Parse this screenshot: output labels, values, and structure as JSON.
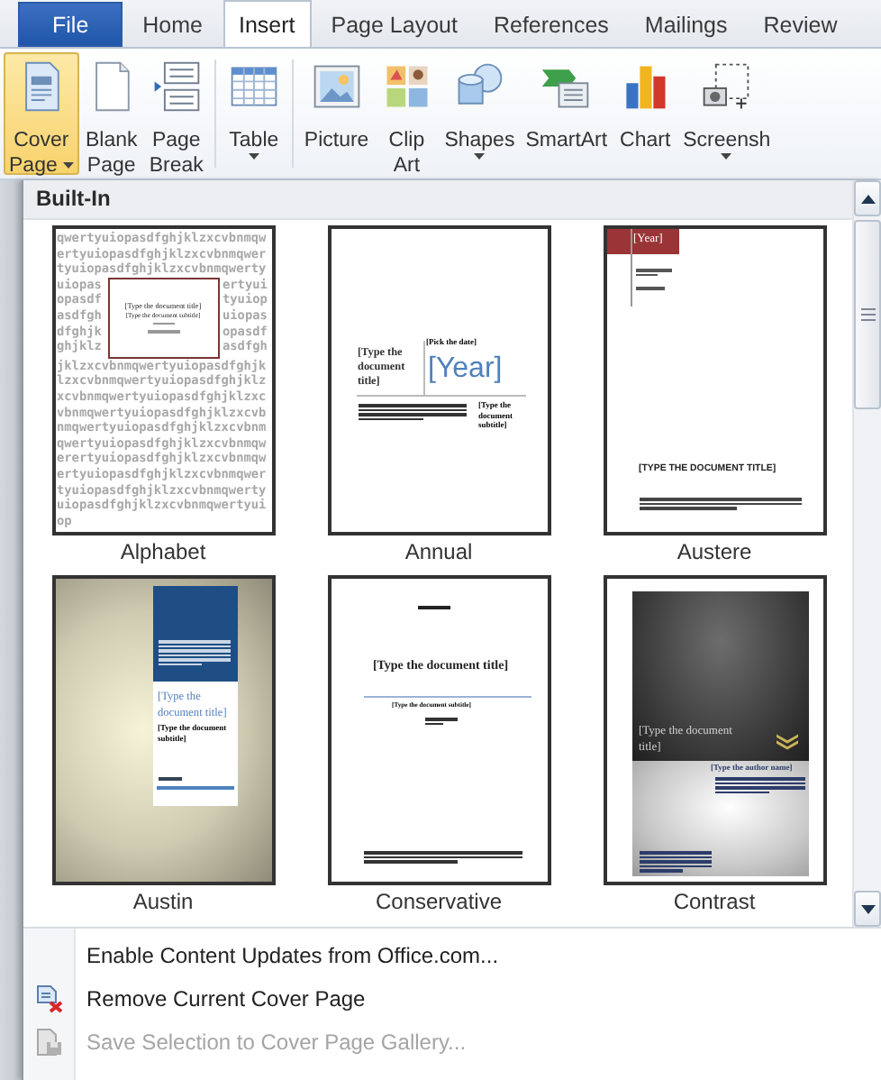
{
  "tabs": [
    {
      "label": "File",
      "kind": "file",
      "selected": false
    },
    {
      "label": "Home",
      "kind": "tab",
      "selected": false
    },
    {
      "label": "Insert",
      "kind": "tab",
      "selected": true
    },
    {
      "label": "Page Layout",
      "kind": "tab",
      "selected": false
    },
    {
      "label": "References",
      "kind": "tab",
      "selected": false
    },
    {
      "label": "Mailings",
      "kind": "tab",
      "selected": false
    },
    {
      "label": "Review",
      "kind": "tab",
      "selected": false
    }
  ],
  "ribbon": {
    "groups": [
      {
        "buttons": [
          {
            "lines": [
              "Cover",
              "Page"
            ],
            "kind": "cover-page",
            "dropdown": true,
            "selected": true
          },
          {
            "lines": [
              "Blank",
              "Page"
            ],
            "kind": "blank-page",
            "dropdown": false,
            "selected": false
          },
          {
            "lines": [
              "Page",
              "Break"
            ],
            "kind": "page-break",
            "dropdown": false,
            "selected": false
          }
        ]
      },
      {
        "buttons": [
          {
            "lines": [
              "Table"
            ],
            "kind": "table",
            "dropdown": true,
            "selected": false
          }
        ]
      },
      {
        "buttons": [
          {
            "lines": [
              "Picture"
            ],
            "kind": "picture",
            "dropdown": false,
            "selected": false
          },
          {
            "lines": [
              "Clip",
              "Art"
            ],
            "kind": "clip-art",
            "dropdown": false,
            "selected": false
          },
          {
            "lines": [
              "Shapes"
            ],
            "kind": "shapes",
            "dropdown": true,
            "selected": false
          },
          {
            "lines": [
              "SmartArt"
            ],
            "kind": "smartart",
            "dropdown": false,
            "selected": false
          },
          {
            "lines": [
              "Chart"
            ],
            "kind": "chart",
            "dropdown": false,
            "selected": false
          },
          {
            "lines": [
              "Screensh"
            ],
            "kind": "screenshot",
            "dropdown": true,
            "selected": false
          }
        ]
      }
    ]
  },
  "gallery": {
    "heading": "Built-In",
    "items": [
      {
        "name": "Alphabet",
        "kind": "alphabet",
        "texts": [
          "qwertyuiopasdfghjklzxcvbnmqwertyuiopasdfghjklzxcvbnmqwertyuiopasdfghjklzxcvbnmqwerty",
          "[Type the document title]",
          "[Type the document subtitle]",
          "uiopasopasdfasdfghdfghjkghjklz",
          "ertyuityuiopuiopasopasdfasdfgh",
          "jklzxcvbnmqwertyuiopasdfghjklzxcvbnmqwertyuiopasdfghjklzxcvbnmqwertyuiopasdfghjklzxcvbnmqwertyuiopasdfghjklzxcvbnmqwertyuiopasdfghjklzxcvbnmqwertyuiopasdfghjklzxcvbnmqwerertyuiopasdfghjklzxcvbnmqwertyuiopasdfghjklzxcvbnmqwertyuiopasdfghjklzxcvbnmqwertyuiopasdfghjklzxcvbnmqwertyuiop"
        ]
      },
      {
        "name": "Annual",
        "kind": "annual",
        "texts": [
          "[Type the document title]",
          "[Pick the date]",
          "[Year]",
          "[Type the document subtitle]"
        ]
      },
      {
        "name": "Austere",
        "kind": "austere",
        "texts": [
          "[Year]",
          "[TYPE THE DOCUMENT TITLE]"
        ]
      },
      {
        "name": "Austin",
        "kind": "austin",
        "texts": [
          "[Type the document title]",
          "[Type the document subtitle]"
        ]
      },
      {
        "name": "Conservative",
        "kind": "conservative",
        "texts": [
          "[Type the document title]",
          "[Type the document subtitle]"
        ]
      },
      {
        "name": "Contrast",
        "kind": "contrast",
        "texts": [
          "[Type the document title]",
          "[Type the author name]"
        ]
      }
    ]
  },
  "menu": [
    {
      "label": "Enable Content Updates from Office.com...",
      "kind": "plain",
      "disabled": false
    },
    {
      "label": "Remove Current Cover Page",
      "kind": "remove",
      "disabled": false
    },
    {
      "label": "Save Selection to Cover Page Gallery...",
      "kind": "save",
      "disabled": true
    }
  ]
}
